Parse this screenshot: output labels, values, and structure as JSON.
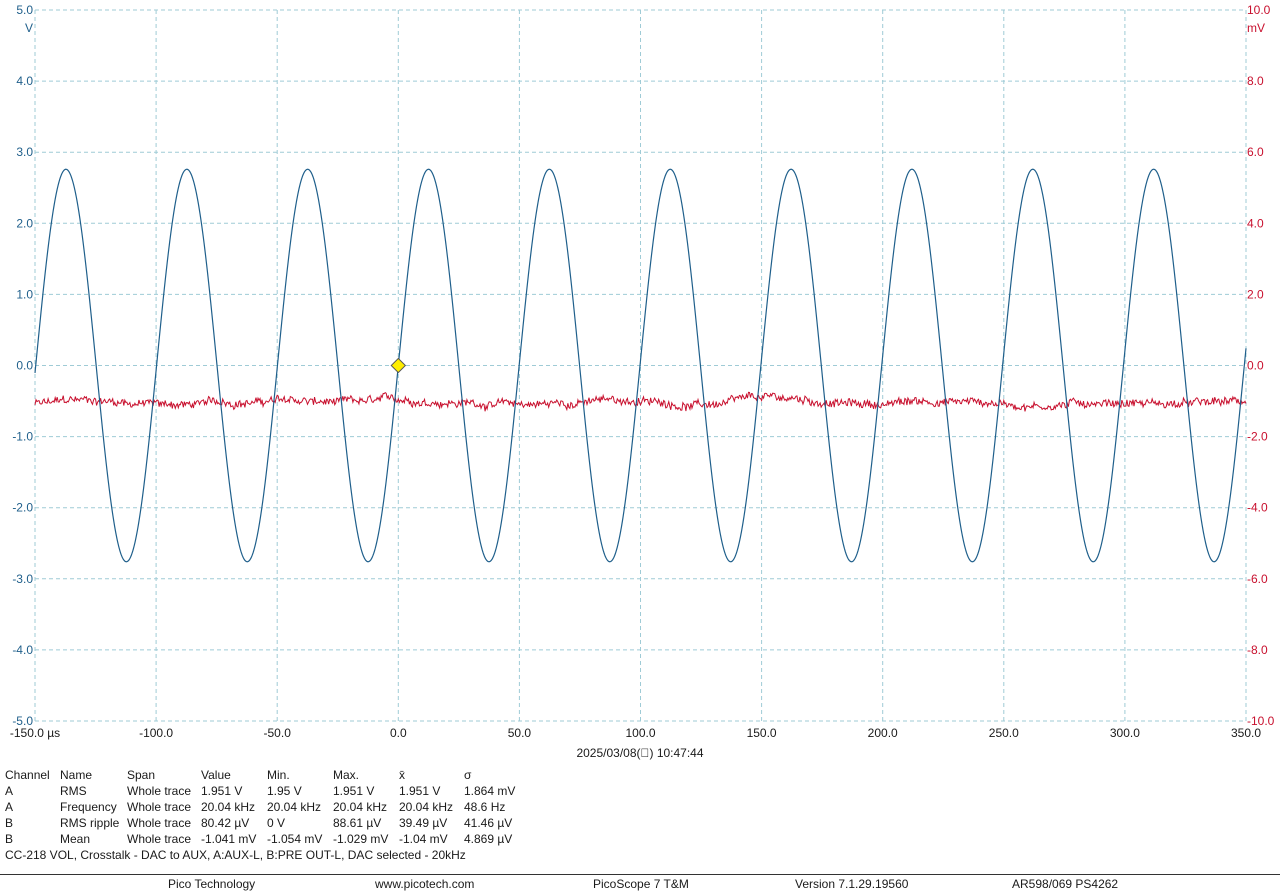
{
  "chart_data": {
    "type": "line",
    "xlim": [
      -150,
      350
    ],
    "x_ticks": [
      "-150.0 µs",
      "-100.0",
      "-50.0",
      "0.0",
      "50.0",
      "100.0",
      "150.0",
      "200.0",
      "250.0",
      "300.0",
      "350.0"
    ],
    "y_left": {
      "unit": "V",
      "ylim": [
        -5,
        5
      ],
      "ticks": [
        "5.0",
        "4.0",
        "3.0",
        "2.0",
        "1.0",
        "0.0",
        "-1.0",
        "-2.0",
        "-3.0",
        "-4.0",
        "-5.0"
      ],
      "color": "#1f5f8b"
    },
    "y_right": {
      "unit": "mV",
      "ylim": [
        -10,
        10
      ],
      "ticks": [
        "10.0",
        "8.0",
        "6.0",
        "4.0",
        "2.0",
        "0.0",
        "-2.0",
        "-4.0",
        "-6.0",
        "-8.0",
        "-10.0"
      ],
      "color": "#c8102e"
    },
    "grid": true,
    "trigger": {
      "x": 0,
      "y": 0,
      "color": "#ffee00"
    },
    "series": [
      {
        "channel": "A",
        "axis": "left",
        "waveform": "sine",
        "amplitude": 2.76,
        "frequency_khz": 20.04,
        "color": "#1f5f8b"
      },
      {
        "channel": "B",
        "axis": "right",
        "waveform": "noise",
        "mean": -1.041,
        "ripple_rms": 0.0804,
        "color": "#c8102e"
      }
    ]
  },
  "timestamp": "2025/03/08(\u0000) 10:47:44",
  "measurements": {
    "headers": [
      "Channel",
      "Name",
      "Span",
      "Value",
      "Min.",
      "Max.",
      "x̄",
      "σ"
    ],
    "rows": [
      [
        "A",
        "RMS",
        "Whole trace",
        "1.951 V",
        "1.95 V",
        "1.951 V",
        "1.951 V",
        "1.864 mV"
      ],
      [
        "A",
        "Frequency",
        "Whole trace",
        "20.04 kHz",
        "20.04 kHz",
        "20.04 kHz",
        "20.04 kHz",
        "48.6 Hz"
      ],
      [
        "B",
        "RMS ripple",
        "Whole trace",
        "80.42 µV",
        "0 V",
        "88.61 µV",
        "39.49 µV",
        "41.46 µV"
      ],
      [
        "B",
        "Mean",
        "Whole trace",
        "-1.041 mV",
        "-1.054 mV",
        "-1.029 mV",
        "-1.04 mV",
        "4.869 µV"
      ]
    ]
  },
  "caption": "CC-218 VOL, Crosstalk - DAC to AUX, A:AUX-L, B:PRE OUT-L, DAC selected - 20kHz",
  "footer": {
    "company": "Pico Technology",
    "website": "www.picotech.com",
    "product": "PicoScope 7 T&M",
    "version": "Version 7.1.29.19560",
    "device": "AR598/069 PS4262"
  }
}
